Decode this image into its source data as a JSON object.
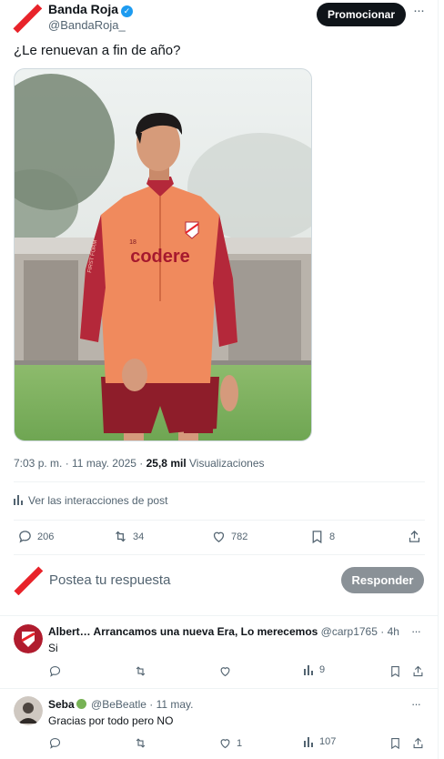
{
  "post": {
    "author_name": "Banda Roja",
    "author_handle": "@BandaRoja_",
    "promote_label": "Promocionar",
    "text": "¿Le renuevan a fin de año?",
    "time": "7:03 p. m. · 11 may. 2025 · ",
    "views_count": "25,8 mil",
    "views_label": "Visualizaciones",
    "interactions_label": "Ver las interacciones de post",
    "replies": "206",
    "reposts": "34",
    "likes": "782",
    "bookmarks": "8",
    "photo": {
      "jersey_text": "codere",
      "number": "18",
      "sleeve_text": "FIRST FORM"
    }
  },
  "compose": {
    "placeholder": "Postea tu respuesta",
    "reply_label": "Responder"
  },
  "comments": [
    {
      "name": "Albert… Arrancamos una nueva Era, Lo merecemos",
      "handle": "@carp1765",
      "time": "· 4h",
      "text": "Si",
      "replies": "",
      "reposts": "",
      "likes": "",
      "views": "9"
    },
    {
      "name": "Seba",
      "handle": "@BeBeatle",
      "time": "· 11 may.",
      "text": "Gracias por todo pero NO",
      "replies": "",
      "reposts": "",
      "likes": "1",
      "views": "107"
    }
  ],
  "colors": {
    "accent": "#1d9bf0",
    "brand_red": "#e8232a",
    "primary_button": "#0f1419",
    "disabled_button": "#8a9197",
    "secondary_text": "#536471"
  }
}
